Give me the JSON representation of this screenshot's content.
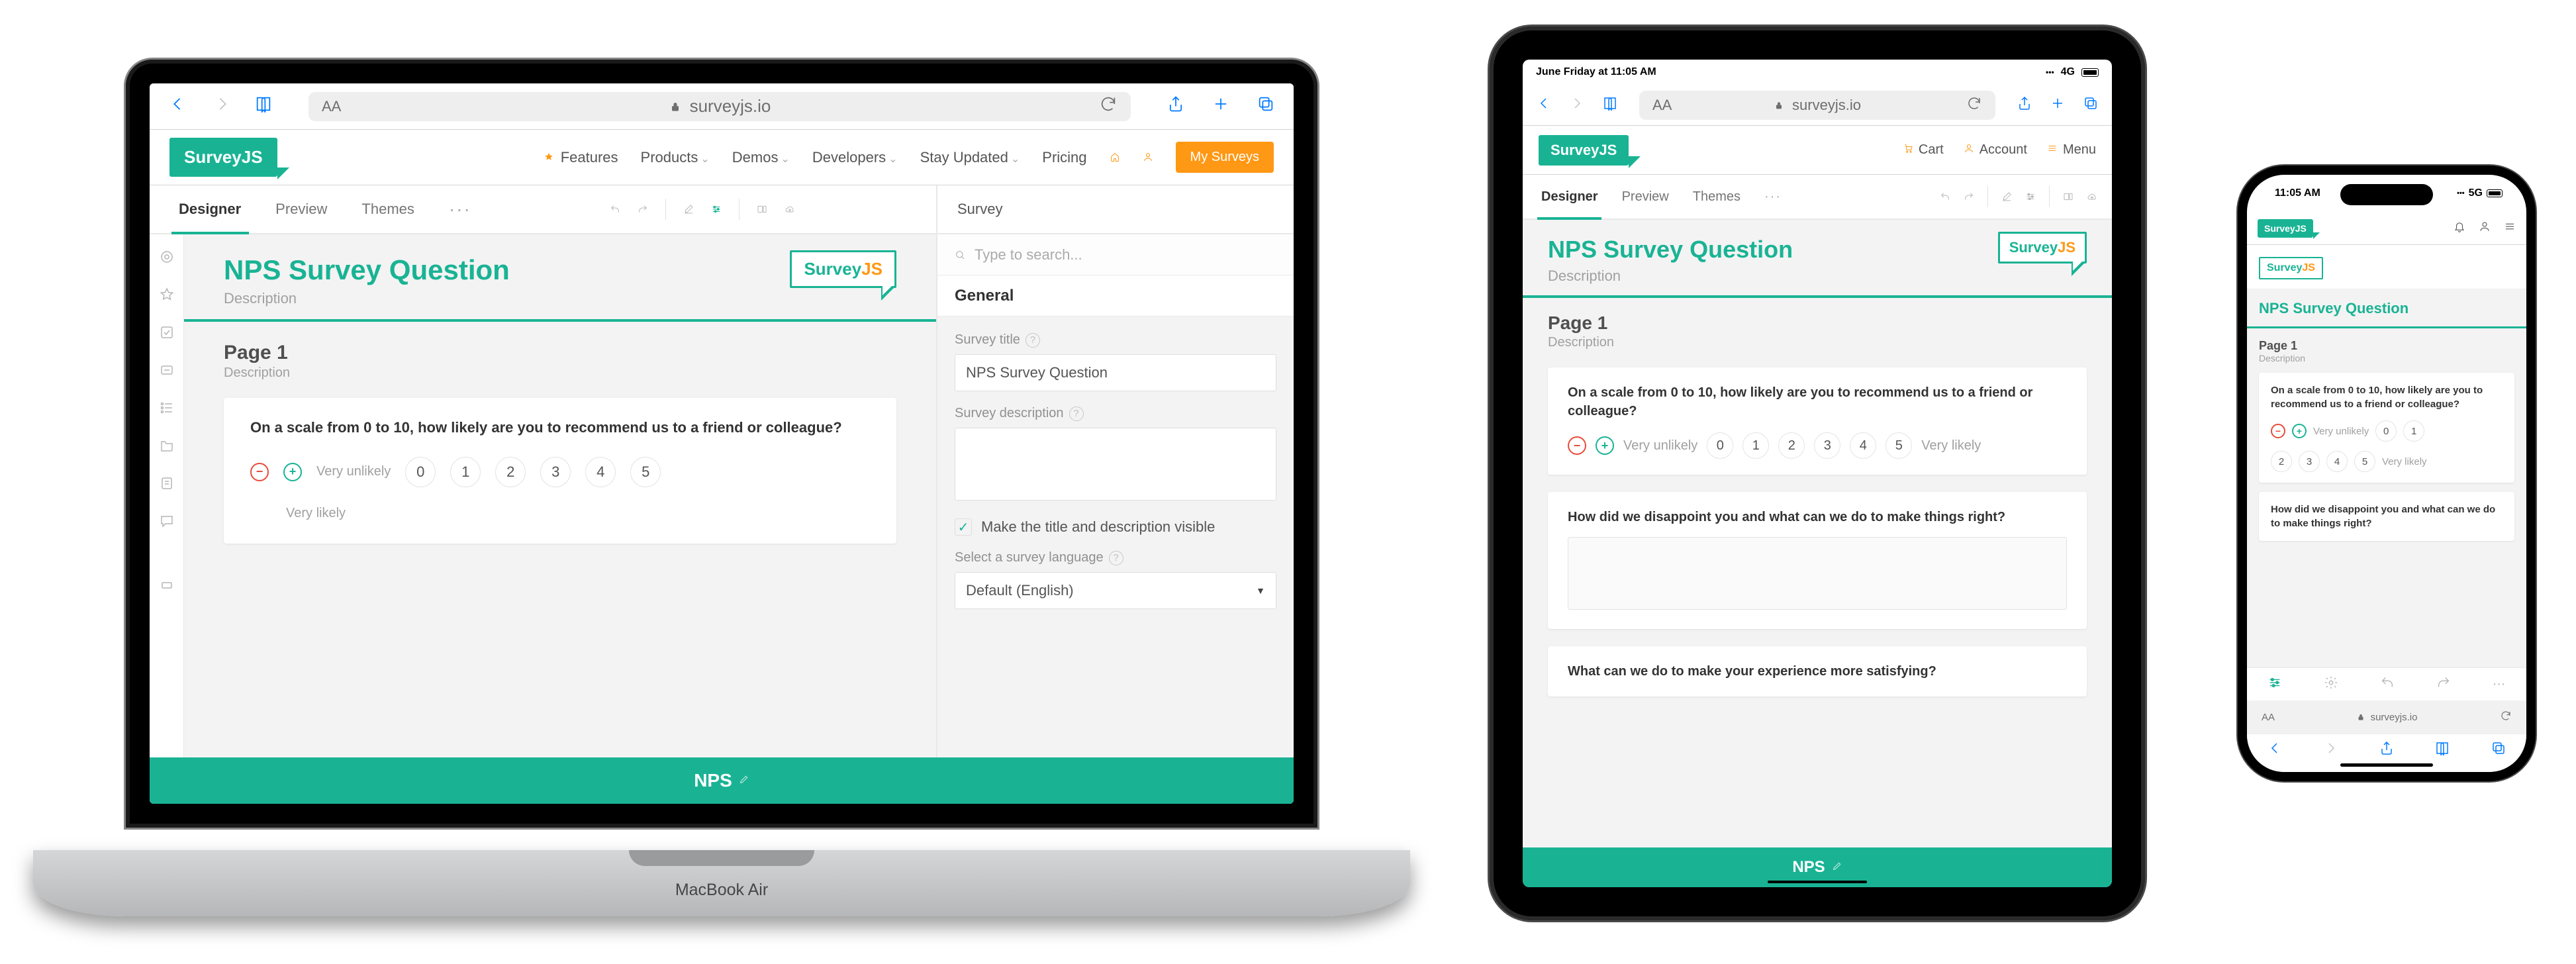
{
  "safari": {
    "url": "surveyjs.io"
  },
  "logo": {
    "brand_s": "Survey",
    "brand_j": "JS"
  },
  "top_nav": {
    "features": "Features",
    "products": "Products",
    "demos": "Demos",
    "developers": "Developers",
    "stay_updated": "Stay Updated",
    "pricing": "Pricing",
    "my_surveys": "My Surveys"
  },
  "creator": {
    "tabs": {
      "designer": "Designer",
      "preview": "Preview",
      "themes": "Themes"
    },
    "survey_label": "Survey"
  },
  "designer": {
    "title": "NPS Survey Question",
    "description_ph": "Description",
    "page": {
      "title": "Page 1",
      "description_ph": "Description"
    },
    "questions": {
      "q1": {
        "text": "On a scale from 0 to 10, how likely are you to recommend us to a friend or colleague?",
        "min_label": "Very unlikely",
        "max_label": "Very likely",
        "values_d": [
          "0",
          "1",
          "2",
          "3",
          "4",
          "5"
        ],
        "values_t1": [
          "0",
          "1",
          "2",
          "3",
          "4",
          "5"
        ],
        "values_ph_a": [
          "0",
          "1"
        ],
        "values_ph_b": [
          "2",
          "3",
          "4",
          "5"
        ]
      },
      "q2": {
        "text": "How did we disappoint you and what can we do to make things right?"
      },
      "q3": {
        "text": "What can we do to make your experience more satisfying?"
      }
    },
    "footer": "NPS"
  },
  "properties": {
    "search_ph": "Type to search...",
    "section": "General",
    "survey_title_label": "Survey title",
    "survey_title_value": "NPS Survey Question",
    "survey_desc_label": "Survey description",
    "title_visible_label": "Make the title and description visible",
    "language_label": "Select a survey language",
    "language_value": "Default (English)"
  },
  "ipad": {
    "status_time": "June Friday at 11:05 AM",
    "status_net": "4G",
    "nav": {
      "cart": "Cart",
      "account": "Account",
      "menu": "Menu"
    }
  },
  "iphone": {
    "status_time": "11:05 AM",
    "status_net": "5G"
  },
  "macbook_label": "MacBook Air"
}
